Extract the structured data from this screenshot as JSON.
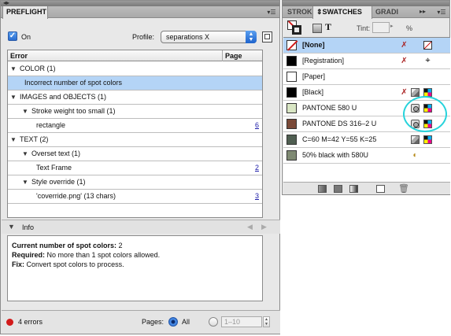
{
  "preflight": {
    "tab_label": "PREFLIGHT",
    "on_label": "On",
    "profile_label": "Profile:",
    "profile_value": "separations X",
    "columns": {
      "error": "Error",
      "page": "Page"
    },
    "rows": [
      {
        "indent": 0,
        "toggle": "▼",
        "label": "COLOR (1)",
        "page": "",
        "selected": false
      },
      {
        "indent": 2,
        "toggle": "",
        "label": "Incorrect number of spot colors",
        "page": "",
        "selected": true
      },
      {
        "indent": 0,
        "toggle": "▼",
        "label": "IMAGES and OBJECTS (1)",
        "page": "",
        "selected": false
      },
      {
        "indent": 1,
        "toggle": "▼",
        "label": "Stroke weight too small (1)",
        "page": "",
        "selected": false
      },
      {
        "indent": 2,
        "toggle": "",
        "label": "rectangle",
        "page": "6",
        "selected": false
      },
      {
        "indent": 0,
        "toggle": "▼",
        "label": "TEXT (2)",
        "page": "",
        "selected": false
      },
      {
        "indent": 1,
        "toggle": "▼",
        "label": "Overset text (1)",
        "page": "",
        "selected": false
      },
      {
        "indent": 2,
        "toggle": "",
        "label": "Text Frame",
        "page": "2",
        "selected": false
      },
      {
        "indent": 1,
        "toggle": "▼",
        "label": "Style override (1)",
        "page": "",
        "selected": false
      },
      {
        "indent": 2,
        "toggle": "",
        "label": "'coverride.png' (13 chars)",
        "page": "3",
        "selected": false
      }
    ],
    "info": {
      "label": "Info",
      "line1_bold": "Current number of spot colors:",
      "line1_rest": " 2",
      "line2_bold": "Required:",
      "line2_rest": " No more than 1 spot colors allowed.",
      "line3_bold": "Fix:",
      "line3_rest": " Convert spot colors to process."
    },
    "status": {
      "errors": "4 errors",
      "pages_label": "Pages:",
      "all_label": "All",
      "range_placeholder": "1–10"
    }
  },
  "swatches": {
    "tabs": [
      "STROK",
      "SWATCHES",
      "GRADI"
    ],
    "tint_label": "Tint:",
    "tint_value": "",
    "percent": "%",
    "items": [
      {
        "name": "[None]",
        "color": "#ffffff",
        "selected": true,
        "icons": [
          "noedit",
          "none"
        ]
      },
      {
        "name": "[Registration]",
        "color": "#000000",
        "selected": false,
        "icons": [
          "noedit",
          "reg"
        ]
      },
      {
        "name": "[Paper]",
        "color": "#ffffff",
        "selected": false,
        "icons": []
      },
      {
        "name": "[Black]",
        "color": "#000000",
        "selected": false,
        "icons": [
          "noedit",
          "mixed",
          "cmyk"
        ]
      },
      {
        "name": "PANTONE 580 U",
        "color": "#d9e6c4",
        "selected": false,
        "icons": [
          "spot",
          "cmyk"
        ]
      },
      {
        "name": "PANTONE DS 316–2 U",
        "color": "#7a4a38",
        "selected": false,
        "icons": [
          "spot",
          "cmyk"
        ]
      },
      {
        "name": "C=60 M=42 Y=55 K=25",
        "color": "#4f5e51",
        "selected": false,
        "icons": [
          "mixed",
          "cmyk"
        ]
      },
      {
        "name": "50% black with 580U",
        "color": "#7f8a73",
        "selected": false,
        "icons": [
          "tint"
        ]
      }
    ]
  }
}
